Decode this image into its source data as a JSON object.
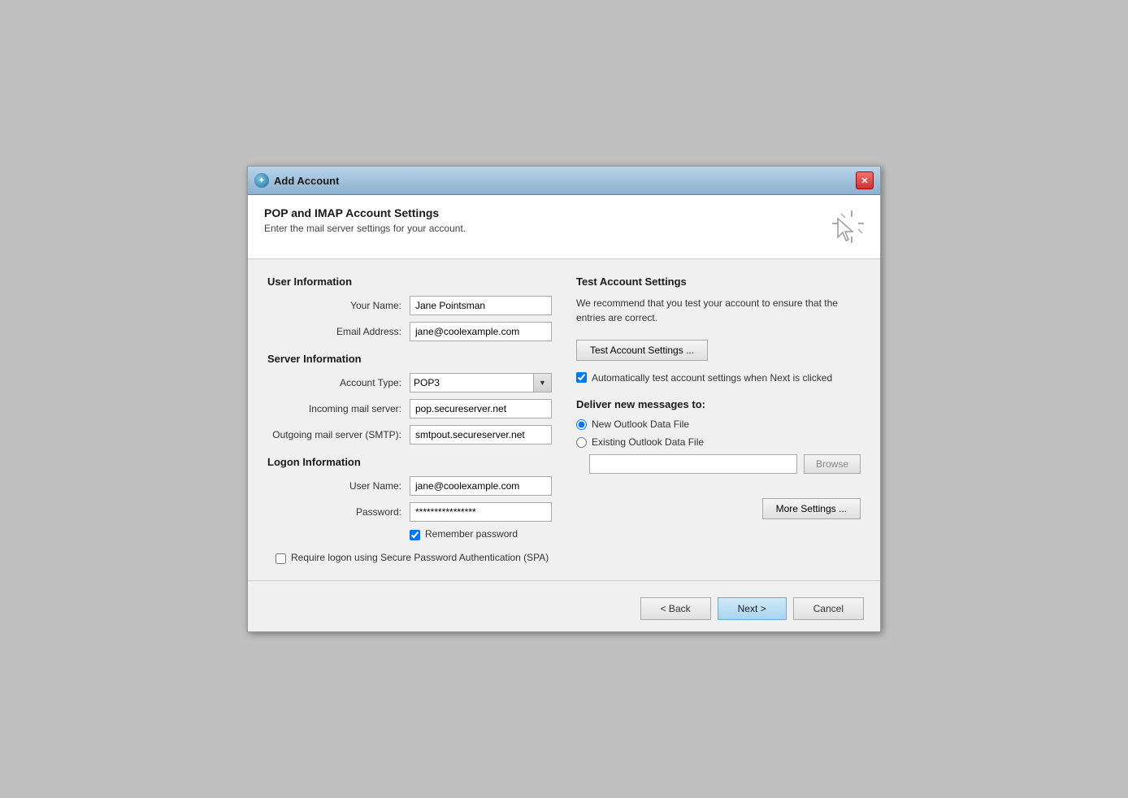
{
  "window": {
    "title": "Add Account",
    "close_label": "✕"
  },
  "header": {
    "title": "POP and IMAP Account Settings",
    "subtitle": "Enter the mail server settings for your account."
  },
  "user_information": {
    "section_title": "User Information",
    "your_name_label": "Your Name:",
    "your_name_value": "Jane Pointsman",
    "email_address_label": "Email Address:",
    "email_address_value": "jane@coolexample.com"
  },
  "server_information": {
    "section_title": "Server Information",
    "account_type_label": "Account Type:",
    "account_type_value": "POP3",
    "incoming_label": "Incoming mail server:",
    "incoming_value": "pop.secureserver.net",
    "outgoing_label": "Outgoing mail server (SMTP):",
    "outgoing_value": "smtpout.secureserver.net"
  },
  "logon_information": {
    "section_title": "Logon Information",
    "username_label": "User Name:",
    "username_value": "jane@coolexample.com",
    "password_label": "Password:",
    "password_value": "****************",
    "remember_password_label": "Remember password",
    "remember_password_checked": true,
    "spa_label": "Require logon using Secure Password Authentication (SPA)",
    "spa_checked": false
  },
  "test_account": {
    "section_title": "Test Account Settings",
    "description": "We recommend that you test your account to ensure that the entries are correct.",
    "test_button_label": "Test Account Settings ...",
    "auto_test_label": "Automatically test account settings when Next is clicked",
    "auto_test_checked": true
  },
  "deliver": {
    "section_title": "Deliver new messages to:",
    "new_data_file_label": "New Outlook Data File",
    "existing_data_file_label": "Existing Outlook Data File",
    "selected_radio": "new",
    "browse_placeholder": "",
    "browse_button_label": "Browse"
  },
  "more_settings": {
    "button_label": "More Settings ..."
  },
  "footer": {
    "back_label": "< Back",
    "next_label": "Next >",
    "cancel_label": "Cancel"
  }
}
